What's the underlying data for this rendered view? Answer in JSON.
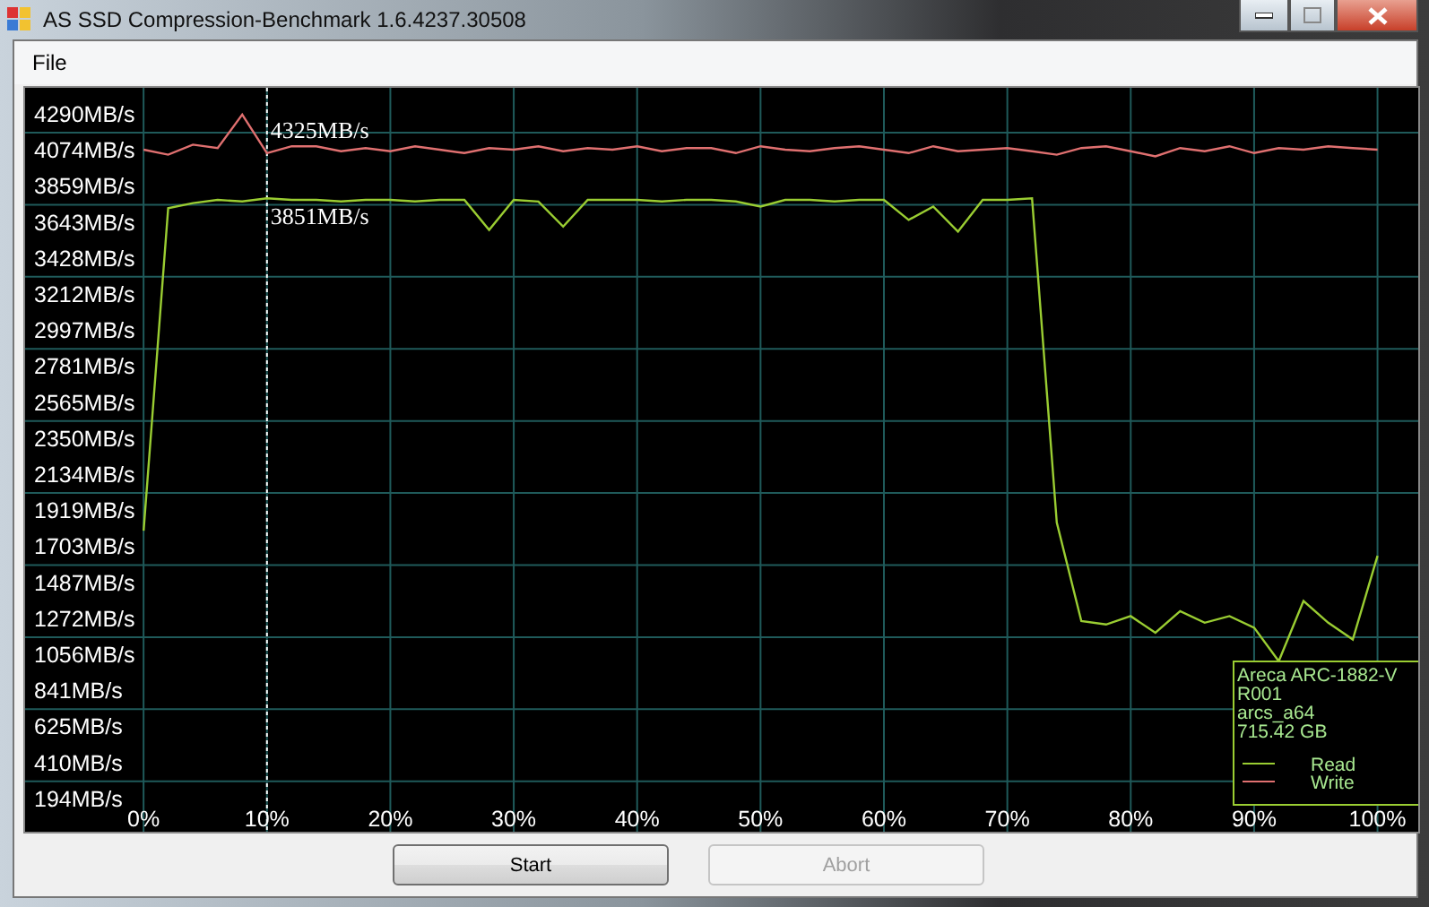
{
  "window": {
    "title": "AS SSD Compression-Benchmark 1.6.4237.30508"
  },
  "menu": [
    "File"
  ],
  "chart": {
    "chart_data": {
      "type": "line",
      "xlim": [
        -9.6,
        103.3
      ],
      "ylim": [
        0,
        4450
      ],
      "legend": "lower right",
      "grid": true,
      "ref_lines": [
        {
          "axis": "x",
          "value": 10
        }
      ],
      "x": [
        0,
        2,
        4,
        6,
        8,
        10,
        12,
        14,
        16,
        18,
        20,
        22,
        24,
        26,
        28,
        30,
        32,
        34,
        36,
        38,
        40,
        42,
        44,
        46,
        48,
        50,
        52,
        54,
        56,
        58,
        60,
        62,
        64,
        66,
        68,
        70,
        72,
        74,
        76,
        78,
        80,
        82,
        84,
        86,
        88,
        90,
        92,
        94,
        96,
        98,
        100
      ],
      "series": [
        {
          "name": "Read",
          "color": "#9acd32",
          "values": [
            1800,
            3730,
            3760,
            3780,
            3770,
            3790,
            3780,
            3780,
            3770,
            3780,
            3780,
            3770,
            3780,
            3780,
            3600,
            3780,
            3770,
            3620,
            3780,
            3780,
            3780,
            3770,
            3780,
            3780,
            3770,
            3740,
            3780,
            3780,
            3770,
            3780,
            3780,
            3660,
            3740,
            3590,
            3780,
            3780,
            3790,
            1850,
            1260,
            1240,
            1290,
            1190,
            1320,
            1250,
            1290,
            1220,
            1020,
            1380,
            1250,
            1150,
            1650
          ]
        },
        {
          "name": "Write",
          "color": "#e07070",
          "values": [
            4080,
            4050,
            4110,
            4090,
            4290,
            4060,
            4100,
            4100,
            4070,
            4090,
            4070,
            4100,
            4080,
            4060,
            4090,
            4080,
            4100,
            4070,
            4090,
            4080,
            4100,
            4070,
            4090,
            4090,
            4060,
            4100,
            4080,
            4070,
            4090,
            4100,
            4080,
            4060,
            4100,
            4070,
            4080,
            4090,
            4070,
            4050,
            4090,
            4100,
            4070,
            4040,
            4090,
            4070,
            4100,
            4060,
            4090,
            4080,
            4100,
            4090,
            4080
          ]
        }
      ],
      "yticks": [
        {
          "value": 4290,
          "label": "4290MB/s"
        },
        {
          "value": 4074,
          "label": "4074MB/s"
        },
        {
          "value": 3859,
          "label": "3859MB/s"
        },
        {
          "value": 3643,
          "label": "3643MB/s"
        },
        {
          "value": 3428,
          "label": "3428MB/s"
        },
        {
          "value": 3212,
          "label": "3212MB/s"
        },
        {
          "value": 2997,
          "label": "2997MB/s"
        },
        {
          "value": 2781,
          "label": "2781MB/s"
        },
        {
          "value": 2565,
          "label": "2565MB/s"
        },
        {
          "value": 2350,
          "label": "2350MB/s"
        },
        {
          "value": 2134,
          "label": "2134MB/s"
        },
        {
          "value": 1919,
          "label": "1919MB/s"
        },
        {
          "value": 1703,
          "label": "1703MB/s"
        },
        {
          "value": 1487,
          "label": "1487MB/s"
        },
        {
          "value": 1272,
          "label": "1272MB/s"
        },
        {
          "value": 1056,
          "label": "1056MB/s"
        },
        {
          "value": 841,
          "label": "841MB/s"
        },
        {
          "value": 625,
          "label": "625MB/s"
        },
        {
          "value": 410,
          "label": "410MB/s"
        },
        {
          "value": 194,
          "label": "194MB/s"
        }
      ],
      "xticks": [
        {
          "value": 0,
          "label": "0%"
        },
        {
          "value": 10,
          "label": "10%"
        },
        {
          "value": 20,
          "label": "20%"
        },
        {
          "value": 30,
          "label": "30%"
        },
        {
          "value": 40,
          "label": "40%"
        },
        {
          "value": 50,
          "label": "50%"
        },
        {
          "value": 60,
          "label": "60%"
        },
        {
          "value": 70,
          "label": "70%"
        },
        {
          "value": 80,
          "label": "80%"
        },
        {
          "value": 90,
          "label": "90%"
        },
        {
          "value": 100,
          "label": "100%"
        }
      ],
      "annotations": [
        "4325MB/s",
        "3851MB/s"
      ]
    },
    "device": [
      "Areca ARC-1882-V",
      "R001",
      "arcs_a64",
      "715.42 GB"
    ]
  },
  "buttons": [
    {
      "label": "Start",
      "disabled": false
    },
    {
      "label": "Abort",
      "disabled": true
    }
  ]
}
